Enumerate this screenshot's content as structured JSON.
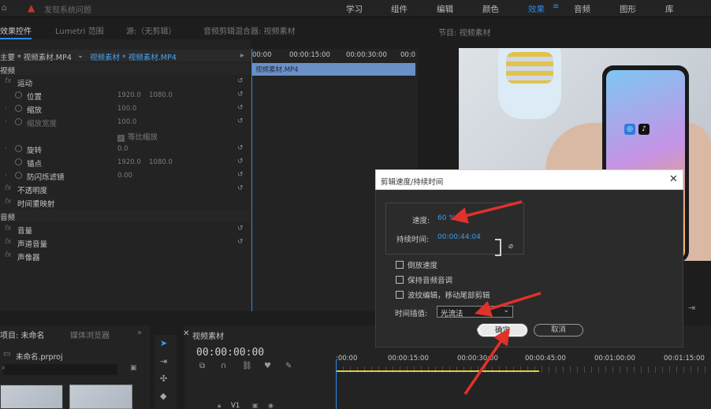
{
  "topbar": {
    "issue_text": "发现系统问题",
    "workspaces": [
      "学习",
      "组件",
      "编辑",
      "颜色",
      "效果",
      "音频",
      "图形",
      "库"
    ],
    "active_workspace": "效果"
  },
  "effect_controls": {
    "tabs": [
      "效果控件",
      "Lumetri 范围",
      "源:（无剪辑）",
      "音频剪辑混合器: 视频素材"
    ],
    "header_left": "主要 * 视频素材.MP4",
    "header_right": "视频素材 * 视频素材.MP4",
    "video_section": "视频",
    "motion": "运动",
    "position_label": "位置",
    "position_x": "1920.0",
    "position_y": "1080.0",
    "scale_label": "缩放",
    "scale_value": "100.0",
    "scale_width_label": "缩放宽度",
    "scale_width_value": "100.0",
    "uniform_scale": "等比缩放",
    "rotation_label": "旋转",
    "rotation_value": "0.0",
    "anchor_label": "锚点",
    "anchor_x": "1920.0",
    "anchor_y": "1080.0",
    "flicker_label": "防闪烁滤镜",
    "flicker_value": "0.00",
    "opacity": "不透明度",
    "time_remap": "时间重映射",
    "audio_section": "音频",
    "volume": "音量",
    "channel_volume": "声道音量",
    "panner": "声像器",
    "ruler": [
      "00:00",
      "00:00:15:00",
      "00:00:30:00",
      "00:0"
    ],
    "clip_label": "视频素材.MP4"
  },
  "program_monitor": {
    "tab": "节目: 视频素材"
  },
  "project": {
    "tabs": [
      "项目: 未命名",
      "媒体浏览器"
    ],
    "file": "未命名.prproj"
  },
  "timeline": {
    "tab": "视频素材",
    "timecode": "00:00:00:00",
    "ruler": [
      ":00:00",
      "00:00:15:00",
      "00:00:30:00",
      "00:00:45:00",
      "00:01:00:00",
      "00:01:15:00"
    ],
    "track": "V1"
  },
  "dialog": {
    "title": "剪辑速度/持续时间",
    "speed_label": "速度:",
    "speed_value": "60 %",
    "duration_label": "持续时间:",
    "duration_value": "00:00:44:04",
    "reverse_label": "倒放速度",
    "maintain_pitch_label": "保持音频音调",
    "ripple_label": "波纹编辑，移动尾部剪辑",
    "interp_label": "时间插值:",
    "interp_value": "光流法",
    "ok_label": "确定",
    "cancel_label": "取消"
  },
  "colors": {
    "accent": "#2d8ceb",
    "arrow": "#e0322b",
    "clip": "#6b8fc7",
    "work_area": "#e6c940"
  }
}
